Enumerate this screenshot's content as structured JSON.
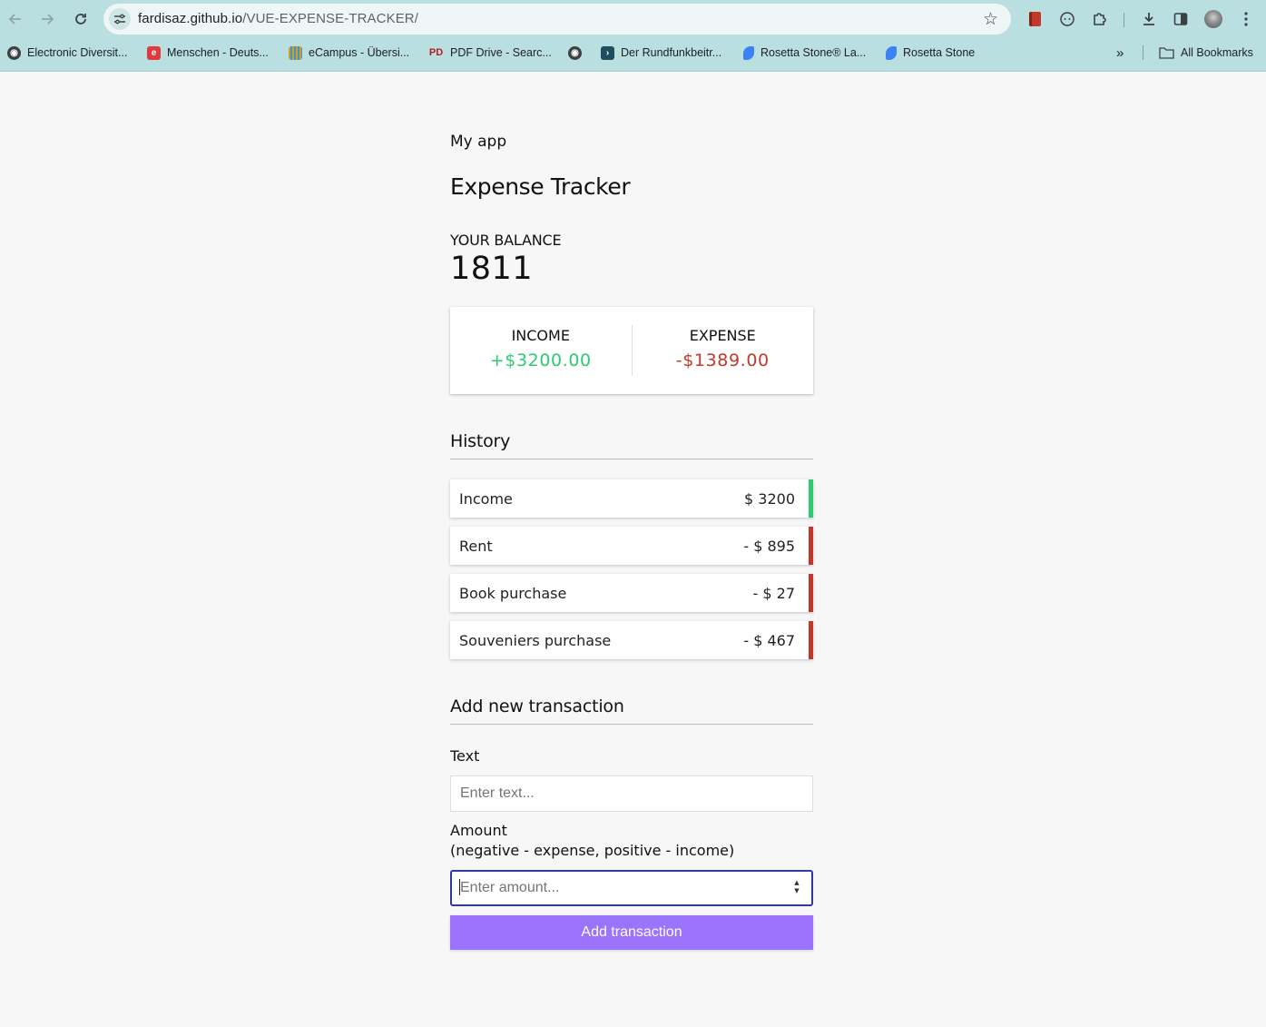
{
  "browser": {
    "url_host": "fardisaz.github.io",
    "url_path": "/VUE-EXPENSE-TRACKER/",
    "bookmarks": [
      {
        "label": "Electronic Diversit...",
        "icon": "globe-icon",
        "color": "#3c4043"
      },
      {
        "label": "Menschen - Deuts...",
        "icon": "e-logo-icon",
        "color": "#e03a3e"
      },
      {
        "label": "eCampus - Übersi...",
        "icon": "ecampus-icon",
        "color": "#c9a227"
      },
      {
        "label": "PDF Drive - Searc...",
        "icon": "pdf-drive-icon",
        "color": "#b32020"
      },
      {
        "label": "",
        "icon": "globe-icon",
        "color": "#3c4043"
      },
      {
        "label": "Der Rundfunkbeitr...",
        "icon": "rundfunk-icon",
        "color": "#1f4e5f"
      },
      {
        "label": "Rosetta Stone® La...",
        "icon": "rosetta-icon",
        "color": "#3b82f6"
      },
      {
        "label": "Rosetta Stone",
        "icon": "rosetta-icon",
        "color": "#3b82f6"
      }
    ],
    "more_bookmarks": "»",
    "all_bookmarks": "All Bookmarks"
  },
  "app": {
    "title": "My app",
    "header": "Expense Tracker",
    "balance_label": "YOUR BALANCE",
    "balance_value": "1811",
    "income_label": "INCOME",
    "income_value": "+$3200.00",
    "expense_label": "EXPENSE",
    "expense_value": "-$1389.00",
    "history_title": "History",
    "transactions": [
      {
        "text": "Income",
        "amount": "$ 3200",
        "type": "plus"
      },
      {
        "text": "Rent",
        "amount": "- $ 895",
        "type": "minus"
      },
      {
        "text": "Book purchase",
        "amount": "- $ 27",
        "type": "minus"
      },
      {
        "text": "Souveniers purchase",
        "amount": "- $ 467",
        "type": "minus"
      }
    ],
    "add_title": "Add new transaction",
    "text_label": "Text",
    "text_placeholder": "Enter text...",
    "amount_label": "Amount",
    "amount_hint": "(negative - expense, positive - income)",
    "amount_placeholder": "Enter amount...",
    "submit_label": "Add transaction"
  },
  "colors": {
    "income": "#2ecc71",
    "expense": "#c0392b",
    "button": "#9c73fb",
    "chrome": "#b9dfe0"
  }
}
